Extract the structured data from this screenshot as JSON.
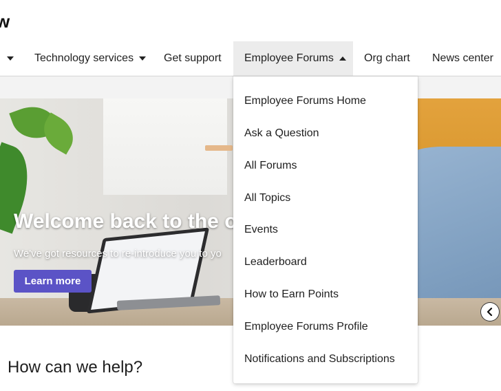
{
  "logo": {
    "text": "w"
  },
  "nav": {
    "items": [
      {
        "label": "Technology services"
      },
      {
        "label": "Get support"
      },
      {
        "label": "Employee Forums"
      },
      {
        "label": "Org chart"
      },
      {
        "label": "News center"
      }
    ]
  },
  "hero": {
    "title": "Welcome back to the of",
    "subtitle": "We've got resources to re-introduce you to yo",
    "cta_label": "Learn more",
    "prev_icon": "chevron-left-icon"
  },
  "help": {
    "heading": "How can we help?"
  },
  "dropdown": {
    "items": [
      {
        "label": "Employee Forums Home"
      },
      {
        "label": "Ask a Question"
      },
      {
        "label": "All Forums"
      },
      {
        "label": "All Topics"
      },
      {
        "label": "Events"
      },
      {
        "label": "Leaderboard"
      },
      {
        "label": "How to Earn Points"
      },
      {
        "label": "Employee Forums Profile"
      },
      {
        "label": "Notifications and Subscriptions"
      }
    ]
  },
  "colors": {
    "accent": "#5b53c6",
    "active_tab_bg": "#ececec"
  }
}
